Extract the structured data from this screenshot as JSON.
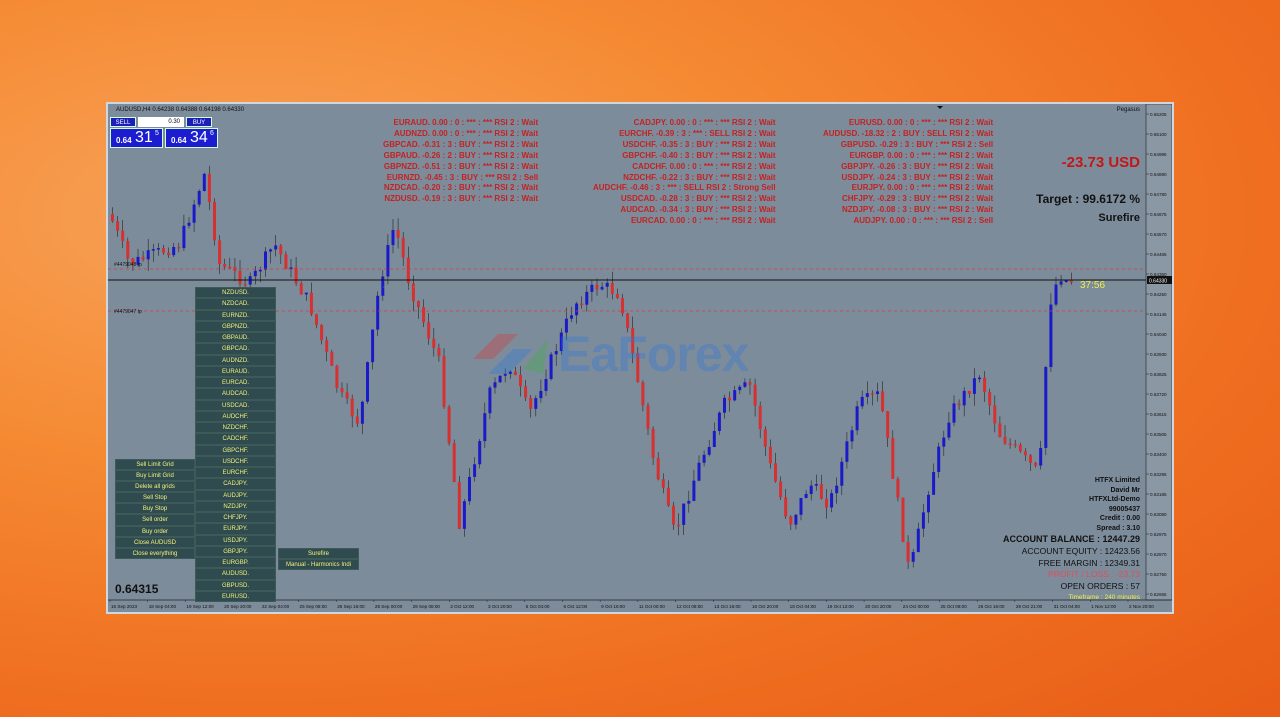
{
  "chart": {
    "title": "AUDUSD,H4  0.64238 0.64388 0.64198 0.64330",
    "top_right_label": "Pegasus",
    "bid_line_label": "0.64330"
  },
  "trade_panel": {
    "sell_label": "SELL",
    "buy_label": "BUY",
    "lot_value": "0.30",
    "sell_price_prefix": "0.64",
    "sell_price_big": "31",
    "sell_price_sup": "5",
    "buy_price_prefix": "0.64",
    "buy_price_big": "34",
    "buy_price_sup": "6"
  },
  "signals": {
    "col1": [
      "EURAUD. 0.00 : 0 : *** : *** RSI 2 : Wait",
      "AUDNZD. 0.00 : 0 : *** : *** RSI 2 : Wait",
      "GBPCAD. -0.31 : 3 : BUY : *** RSI 2 : Wait",
      "GBPAUD. -0.26 : 2 : BUY : *** RSI 2 : Wait",
      "GBPNZD. -0.51 : 3 : BUY : *** RSI 2 : Wait",
      "EURNZD. -0.45 : 3 : BUY : *** RSI 2 : Sell",
      "NZDCAD. -0.20 : 3 : BUY : *** RSI 2 : Wait",
      "NZDUSD. -0.19 : 3 : BUY : *** RSI 2 : Wait"
    ],
    "col2": [
      "CADJPY. 0.00 : 0 : *** : *** RSI 2 : Wait",
      "EURCHF. -0.39 : 3 : *** : SELL RSI 2 : Wait",
      "USDCHF. -0.35 : 3 : BUY : *** RSI 2 : Wait",
      "GBPCHF. -0.40 : 3 : BUY : *** RSI 2 : Wait",
      "CADCHF. 0.00 : 0 : *** : *** RSI 2 : Wait",
      "NZDCHF. -0.22 : 3 : BUY : *** RSI 2 : Wait",
      "AUDCHF. -0.46 : 3 : *** : SELL RSI 2 : Strong Sell",
      "USDCAD. -0.28 : 3 : BUY : *** RSI 2 : Wait",
      "AUDCAD. -0.34 : 3 : BUY : *** RSI 2 : Wait",
      "EURCAD. 0.00 : 0 : *** : *** RSI 2 : Wait"
    ],
    "col3": [
      "EURUSD. 0.00 : 0 : *** : *** RSI 2 : Wait",
      "AUDUSD. -18.32 : 2 : BUY : SELL RSI 2 : Wait",
      "GBPUSD. -0.29 : 3 : BUY : *** RSI 2 : Sell",
      "EURGBP. 0.00 : 0 : *** : *** RSI 2 : Wait",
      "GBPJPY. -0.26 : 3 : BUY : *** RSI 2 : Wait",
      "USDJPY. -0.24 : 3 : BUY : *** RSI 2 : Wait",
      "EURJPY. 0.00 : 0 : *** : *** RSI 2 : Wait",
      "CHFJPY. -0.29 : 3 : BUY : *** RSI 2 : Wait",
      "NZDJPY. -0.08 : 3 : BUY : *** RSI 2 : Wait",
      "AUDJPY. 0.00 : 0 : *** : *** RSI 2 : Sell"
    ]
  },
  "pl_display": "-23.73 USD",
  "target_display": "Target : 99.6172 %",
  "strategy_display": "Surefire",
  "pair_buttons": [
    "NZDUSD.",
    "NZDCAD.",
    "EURNZD.",
    "GBPNZD.",
    "GBPAUD.",
    "GBPCAD.",
    "AUDNZD.",
    "EURAUD.",
    "EURCAD.",
    "AUDCAD.",
    "USDCAD.",
    "AUDCHF.",
    "NZDCHF.",
    "CADCHF.",
    "GBPCHF.",
    "USDCHF.",
    "EURCHF.",
    "CADJPY.",
    "AUDJPY.",
    "NZDJPY.",
    "CHFJPY.",
    "EURJPY.",
    "USDJPY.",
    "GBPJPY.",
    "EURGBP.",
    "AUDUSD.",
    "GBPUSD.",
    "EURUSD."
  ],
  "action_buttons": [
    "Sell Limit Grid",
    "Buy Limit Grid",
    "Delete all grids",
    "Sell Stop",
    "Buy Stop",
    "Sell order",
    "Buy order",
    "Close AUDUSD",
    "Close everything"
  ],
  "strategy_buttons": [
    "Surefire",
    "Manual - Harmonics Indi"
  ],
  "bid_price": "0.64315",
  "candle_timer": "37:56",
  "account": {
    "broker": "HTFX Limited",
    "name": "David Mr",
    "server": "HTFXLtd-Demo",
    "number": "99005437",
    "credit": "Credit : 0.00",
    "spread": "Spread : 3.10",
    "balance": "ACCOUNT BALANCE : 12447.29",
    "equity": "ACCOUNT EQUITY : 12423.56",
    "free_margin": "FREE MARGIN : 12349.31",
    "profit_loss": "PROFIT / LOSS : -23.73",
    "open_orders": "OPEN ORDERS : 57",
    "timeframe": "Timeframe : 240 minutes"
  },
  "price_axis": [
    "0.65205",
    "0.65100",
    "0.64995",
    "0.64890",
    "0.64780",
    "0.64675",
    "0.64570",
    "0.64465",
    "0.64360",
    "0.64250",
    "0.64145",
    "0.64040",
    "0.63930",
    "0.63825",
    "0.63720",
    "0.63615",
    "0.63505",
    "0.63400",
    "0.63295",
    "0.63185",
    "0.63080",
    "0.62975",
    "0.62870",
    "0.62760",
    "0.62655"
  ],
  "time_axis": [
    "15 Sep 2023",
    "18 Sep 04:00",
    "19 Sep 12:00",
    "20 Sep 20:00",
    "22 Sep 04:00",
    "25 Sep 08:00",
    "26 Sep 16:00",
    "28 Sep 00:00",
    "29 Sep 08:00",
    "2 Oct 12:00",
    "3 Oct 20:00",
    "5 Oct 04:00",
    "6 Oct 12:00",
    "9 Oct 16:00",
    "11 Oct 00:00",
    "12 Oct 08:00",
    "13 Oct 16:00",
    "16 Oct 20:00",
    "18 Oct 04:00",
    "19 Oct 12:00",
    "20 Oct 20:00",
    "24 Oct 00:00",
    "25 Oct 08:00",
    "26 Oct 16:00",
    "29 Oct 21:00",
    "31 Oct 04:00",
    "1 Nov 12:00",
    "2 Nov 20:00"
  ],
  "line_labels": {
    "upper": "#4479048 tp",
    "mid1": "BID 0.64330",
    "lower": "#4479047 tp"
  },
  "watermark": "EaForex",
  "colors": {
    "bull": "#1a1ac8",
    "bear": "#d63030",
    "chart_bg": "#7d8c9b",
    "signal_text": "#c42222",
    "button_bg": "#2f4b4f",
    "button_text": "#f3f37a"
  }
}
